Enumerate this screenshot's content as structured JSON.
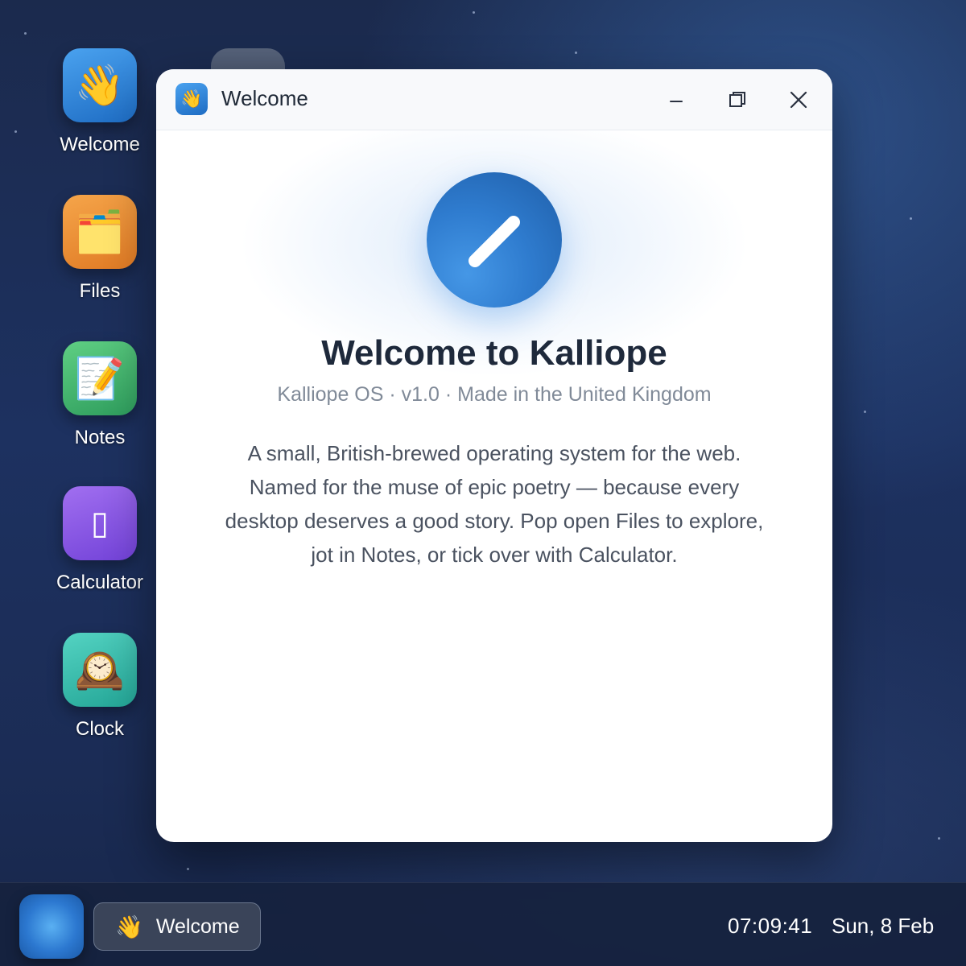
{
  "desktop": {
    "icons": [
      {
        "label": "Welcome",
        "icon": "waving-hand-icon",
        "glyph": "👋",
        "color": "#2f86dc"
      },
      {
        "label": "Files",
        "icon": "folder-icon",
        "glyph": "🗂️",
        "color": "#ec8f35"
      },
      {
        "label": "Notes",
        "icon": "memo-icon",
        "glyph": "📝",
        "color": "#43b46f"
      },
      {
        "label": "Calculator",
        "icon": "calculator-icon",
        "glyph": "▯",
        "color": "#8a58e5"
      },
      {
        "label": "Clock",
        "icon": "mantelpiece-clock-icon",
        "glyph": "🕰️",
        "color": "#36bcaa"
      }
    ]
  },
  "window": {
    "title": "Welcome",
    "icon": "waving-hand-icon",
    "title_glyph": "👋",
    "heading": "Welcome to Kalliope",
    "subtitle": "Kalliope OS · v1.0 · Made in the United Kingdom",
    "body": "A small, British-brewed operating system for the web. Named for the muse of epic poetry — because every desktop deserves a good story. Pop open Files to explore, jot in Notes, or tick over with Calculator."
  },
  "taskbar": {
    "start_icon": "kalliope-start-icon",
    "active_task": {
      "label": "Welcome",
      "glyph": "👋",
      "icon": "waving-hand-icon"
    },
    "time": "07:09:41",
    "date": "Sun, 8 Feb"
  },
  "colors": {
    "accent": "#2f7ccf",
    "desktop_background": "#1d3160"
  }
}
